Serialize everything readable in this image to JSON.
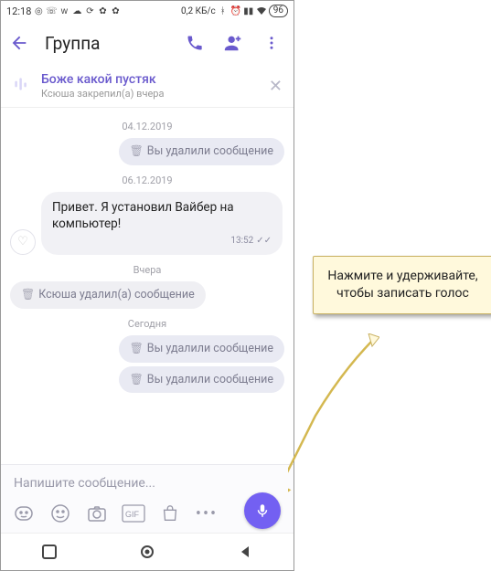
{
  "status_bar": {
    "time": "12:18",
    "data_rate": "0,2 КБ/с",
    "battery": "96"
  },
  "header": {
    "title": "Группа"
  },
  "pinned": {
    "title": "Боже какой пустяк",
    "subtitle": "Ксюша закрепил(а) вчера"
  },
  "chat": {
    "dates": {
      "d1": "04.12.2019",
      "d2": "06.12.2019",
      "d3": "Вчера",
      "d4": "Сегодня"
    },
    "msgs": {
      "deleted_you": "Вы удалили сообщение",
      "deleted_other": "Ксюша удалил(а) сообщение",
      "incoming1": "Привет. Я установил Вайбер на компьютер!",
      "time1": "13:52"
    }
  },
  "input": {
    "placeholder": "Напишите сообщение..."
  },
  "callout": {
    "text": "Нажмите и удерживайте, чтобы записать голос"
  }
}
